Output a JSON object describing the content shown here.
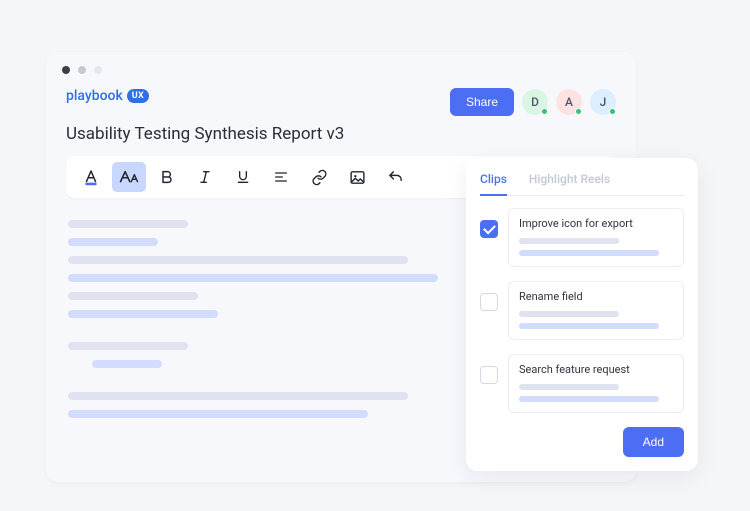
{
  "brand": {
    "name": "playbook",
    "badge": "UX"
  },
  "document": {
    "title": "Usability Testing Synthesis Report v3"
  },
  "header": {
    "share_label": "Share",
    "avatars": [
      {
        "initial": "D",
        "color": "d"
      },
      {
        "initial": "A",
        "color": "a"
      },
      {
        "initial": "J",
        "color": "j"
      }
    ]
  },
  "panel": {
    "tabs": {
      "clips": "Clips",
      "highlight_reels": "Highlight Reels"
    },
    "clips": [
      {
        "title": "Improve icon for export",
        "checked": true
      },
      {
        "title": "Rename field",
        "checked": false
      },
      {
        "title": "Search feature request",
        "checked": false
      }
    ],
    "add_label": "Add"
  }
}
